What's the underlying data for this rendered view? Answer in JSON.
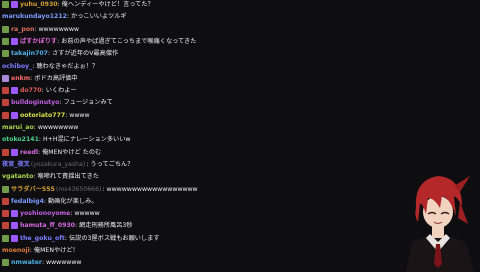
{
  "chat": {
    "messages": [
      {
        "user": "yuhu_0930",
        "display": "",
        "text": "俺ヘンディーやけど！言ってた？",
        "color": "#d4a13a",
        "badges": [
          "#6f9b4a",
          "#9b59ff"
        ]
      },
      {
        "user": "marukundayo1212",
        "display": "",
        "text": "かっこいいよツルギ",
        "color": "#7b9cff",
        "badges": []
      },
      {
        "user": "ra_pon",
        "display": "",
        "text": "wwwwwwww",
        "color": "#e0705e",
        "badges": [
          "#6f9b4a"
        ]
      },
      {
        "user": "ぱすかぽりす",
        "display": "",
        "text": "お前の声やば過ぎてこっちまで喉痛くなってきた",
        "color": "#e26bd9",
        "badges": [
          "#6f9b4a",
          "#9b59ff"
        ]
      },
      {
        "user": "takajin707",
        "display": "",
        "text": "さすが近年のV最高傑作",
        "color": "#4fb0e8",
        "badges": [
          "#6f9b4a"
        ]
      },
      {
        "user": "ochiboy_",
        "display": "",
        "text": "聴わなきゃだよぉ！？",
        "color": "#7b7dff",
        "badges": []
      },
      {
        "user": "enkm",
        "display": "",
        "text": "ボドカ高評価中",
        "color": "#ff6b6b",
        "badges": [
          "#a98bd8"
        ]
      },
      {
        "user": "do770",
        "display": "",
        "text": "いくわよー",
        "color": "#e05a5a",
        "badges": [
          "#c0433c",
          "#9b59ff"
        ]
      },
      {
        "user": "bulldoginutyo",
        "display": "",
        "text": "フュージョンみて",
        "color": "#c060e0",
        "badges": [
          "#c0433c"
        ]
      },
      {
        "user": "ootoriato777",
        "display": "",
        "text": "wwww",
        "color": "#d9e04a",
        "badges": [
          "#c0433c",
          "#9b59ff"
        ]
      },
      {
        "user": "marui_ao",
        "display": "",
        "text": "wwwwwwww",
        "color": "#a8d84e",
        "badges": []
      },
      {
        "user": "otoko2141",
        "display": "",
        "text": "H+H混にナレーション多いいw",
        "color": "#4fd08a",
        "badges": []
      },
      {
        "user": "reedl",
        "display": "",
        "text": "俺MENやけど たのむ",
        "color": "#d46ae0",
        "badges": [
          "#c0433c",
          "#9b59ff"
        ]
      },
      {
        "user": "夜宮_夜叉",
        "display": "(yozakura_yasha)",
        "text": "うってごちん？",
        "color": "#7b7dff",
        "badges": []
      },
      {
        "user": "vgatanto",
        "display": "",
        "text": "喉啼れて責揺出てきた",
        "color": "#a8d84e",
        "badges": []
      },
      {
        "user": "サラダバー555",
        "display": "(ms43650666)",
        "text": "wwwwwwwwwwwwwwwwww",
        "color": "#d4a13a",
        "badges": [
          "#6f9b4a"
        ]
      },
      {
        "user": "fedalbig4",
        "display": "",
        "text": "動画化が楽しみ。",
        "color": "#7b9cff",
        "badges": [
          "#c0433c"
        ]
      },
      {
        "user": "yoshionoyome",
        "display": "",
        "text": "wwwww",
        "color": "#c060e0",
        "badges": [
          "#c0433c",
          "#9b59ff"
        ]
      },
      {
        "user": "hamuta_ff_0930",
        "display": "",
        "text": "網走刑務所風呂3秒",
        "color": "#d46ae0",
        "badges": [
          "#c0433c",
          "#9b59ff"
        ]
      },
      {
        "user": "the_goku_oft",
        "display": "",
        "text": "伝説の3屋ボス戦もお願いします",
        "color": "#7b7dff",
        "badges": [
          "#6f9b4a",
          "#9b59ff"
        ]
      },
      {
        "user": "moenoji",
        "display": "",
        "text": "俺MENやけど！",
        "color": "#e07a3a",
        "badges": []
      },
      {
        "user": "nmwater",
        "display": "",
        "text": "wwwwwww",
        "color": "#4fb0e8",
        "badges": [
          "#6f9b4a"
        ]
      }
    ]
  },
  "avatar": {
    "hair_color": "#b4282a",
    "skin_color": "#f2d3c0"
  }
}
